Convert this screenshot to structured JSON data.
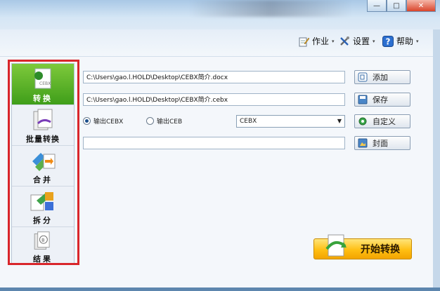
{
  "window": {
    "minimize_glyph": "—",
    "maximize_glyph": "□",
    "close_glyph": "✕"
  },
  "menu": {
    "jobs": "作业",
    "settings": "设置",
    "help": "帮助",
    "caret": "▾"
  },
  "nav": {
    "items": [
      {
        "label": "转换",
        "icon": "document-convert-icon",
        "active": true
      },
      {
        "label": "批量转换",
        "icon": "batch-convert-icon",
        "active": false
      },
      {
        "label": "合并",
        "icon": "merge-icon",
        "active": false
      },
      {
        "label": "拆分",
        "icon": "split-icon",
        "active": false
      },
      {
        "label": "结果",
        "icon": "result-icon",
        "active": false
      }
    ]
  },
  "form": {
    "source_path": "C:\\Users\\gao.l.HOLD\\Desktop\\CEBX简介.docx",
    "output_path": "C:\\Users\\gao.l.HOLD\\Desktop\\CEBX简介.cebx",
    "radio_cebx": "输出CEBX",
    "radio_ceb": "输出CEB",
    "format_select": "CEBX",
    "cover_path": "",
    "buttons": {
      "add": "添加",
      "save": "保存",
      "customize": "自定义",
      "cover": "封面"
    },
    "start": "开始转换"
  },
  "colors": {
    "accent_green": "#4fae24",
    "highlight_red": "#d9262b",
    "start_orange": "#ffbf13"
  }
}
